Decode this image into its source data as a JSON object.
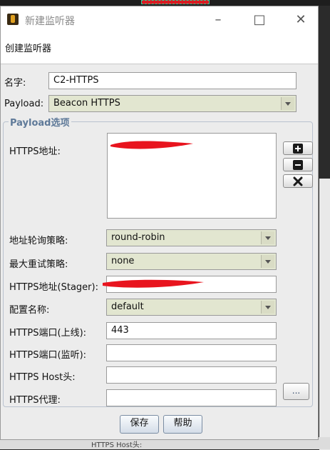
{
  "window": {
    "title": "新建监听器",
    "header": "创建监听器"
  },
  "form": {
    "name_label": "名字:",
    "name_value": "C2-HTTPS",
    "payload_label": "Payload:",
    "payload_value": "Beacon HTTPS",
    "group_title": "Payload选项",
    "hosts_label": "HTTPS地址:",
    "rotate_label": "地址轮询策略:",
    "rotate_value": "round-robin",
    "retry_label": "最大重试策略:",
    "retry_value": "none",
    "stager_label": "HTTPS地址(Stager):",
    "stager_value": "",
    "profile_label": "配置名称:",
    "profile_value": "default",
    "port_c2_label": "HTTPS端口(上线):",
    "port_c2_value": "443",
    "port_bind_label": "HTTPS端口(监听):",
    "port_bind_value": "",
    "host_header_label": "HTTPS Host头:",
    "host_header_value": "",
    "proxy_label": "HTTPS代理:",
    "proxy_value": "",
    "proxy_button": "..."
  },
  "buttons": {
    "save": "保存",
    "help": "帮助"
  },
  "backdrop": {
    "bottom_text": "HTTPS Host头:"
  },
  "icons": [
    "app-icon",
    "minimize-icon",
    "maximize-icon",
    "close-icon",
    "add-icon",
    "remove-icon",
    "clear-icon"
  ],
  "colors": {
    "accent": "#5f7a99",
    "combo_bg": "#e2e6d0",
    "redaction": "#e8141e"
  }
}
